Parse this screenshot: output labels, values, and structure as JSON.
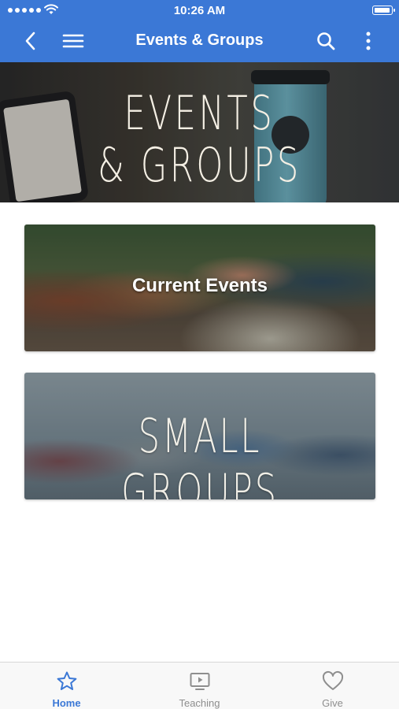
{
  "status_bar": {
    "time": "10:26 AM"
  },
  "nav": {
    "title": "Events & Groups",
    "icons": [
      "back-chevron-icon",
      "hamburger-menu-icon",
      "search-icon",
      "more-vertical-icon"
    ]
  },
  "hero": {
    "line1": "EVENTS",
    "line2": "& GROUPS"
  },
  "cards": [
    {
      "label": "Current Events"
    },
    {
      "label": "SMALL GROUPS"
    }
  ],
  "tabs": [
    {
      "label": "Home",
      "icon": "star-icon",
      "active": true
    },
    {
      "label": "Teaching",
      "icon": "tv-play-icon",
      "active": false
    },
    {
      "label": "Give",
      "icon": "heart-icon",
      "active": false
    }
  ],
  "colors": {
    "accent": "#3b78d6",
    "inactive": "#8e8e8e"
  }
}
